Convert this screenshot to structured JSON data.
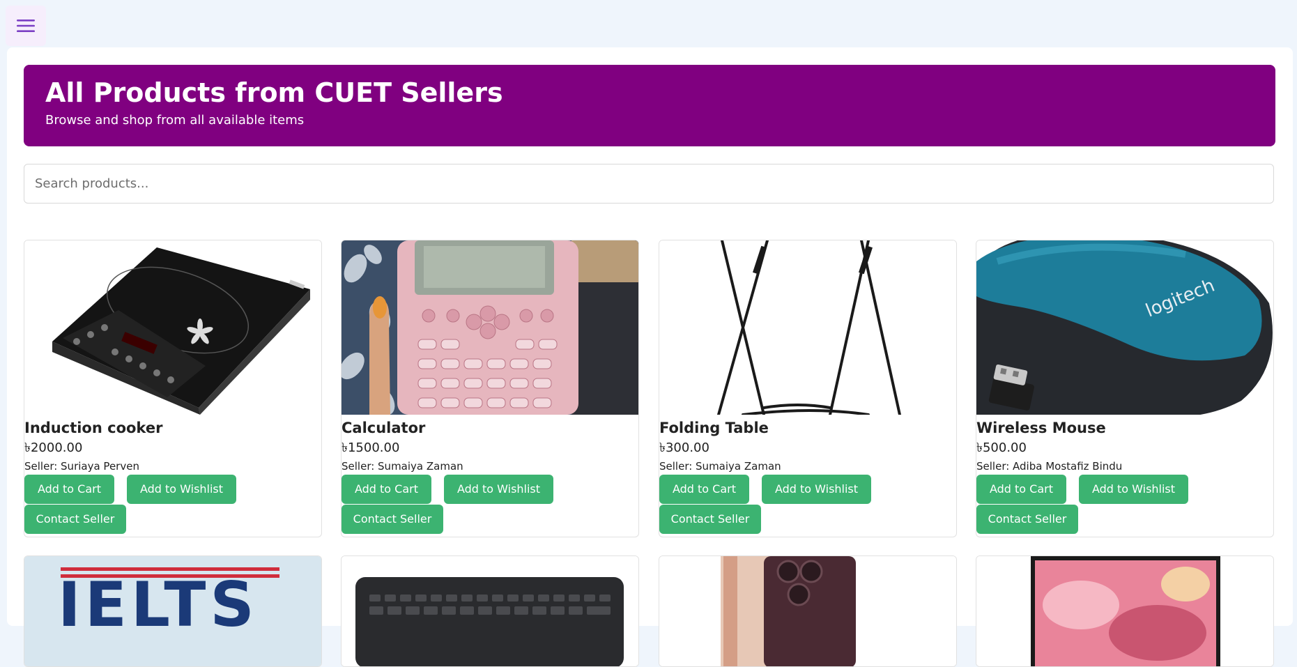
{
  "topbar": {
    "menu_icon": "hamburger-menu-icon"
  },
  "banner": {
    "title": "All Products from CUET Sellers",
    "subtitle": "Browse and shop from all available items",
    "color": "#800080"
  },
  "search": {
    "placeholder": "Search products...",
    "value": ""
  },
  "buttons": {
    "add_to_cart": "Add to Cart",
    "add_to_wishlist": "Add to Wishlist",
    "contact_seller": "Contact Seller",
    "color": "#3cb371"
  },
  "products": [
    {
      "name": "Induction cooker",
      "price": "৳2000.00",
      "seller": "Seller: Suriaya Perven"
    },
    {
      "name": "Calculator",
      "price": "৳1500.00",
      "seller": "Seller: Sumaiya Zaman"
    },
    {
      "name": "Folding Table",
      "price": "৳300.00",
      "seller": "Seller: Sumaiya Zaman"
    },
    {
      "name": "Wireless Mouse",
      "price": "৳500.00",
      "seller": "Seller: Adiba Mostafiz Bindu"
    }
  ],
  "images": {
    "mouse_brand": "logitech",
    "book_title": "IELTS"
  }
}
